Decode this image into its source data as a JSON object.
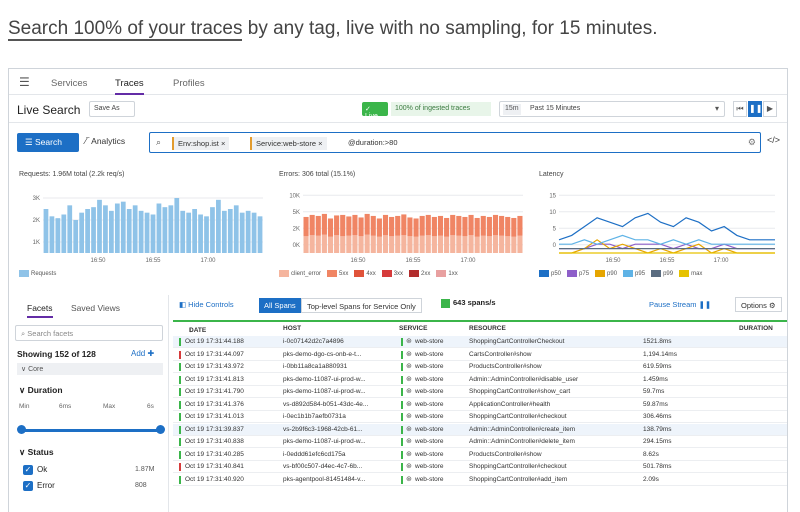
{
  "headline": {
    "link": "Search 100% of your traces",
    "rest": " by any tag, live with no sampling, for 15 minutes."
  },
  "nav": {
    "menu_icon": "menu-icon",
    "tabs": [
      "Services",
      "Traces",
      "Profiles"
    ],
    "active": "Traces"
  },
  "toolbar": {
    "title": "Live Search",
    "save_as": "Save As",
    "live_badge": "✓ Live",
    "ingest": "100% of ingested traces",
    "time_tag": "15m",
    "time_value": "Past 15 Minutes",
    "controls": [
      "⏮",
      "❚❚",
      "▶"
    ]
  },
  "search": {
    "search_label": "Search",
    "analytics_label": "Analytics",
    "chips": [
      "Env:shop.ist ×",
      "Service:web-store ×"
    ],
    "free_text": "@duration:>80"
  },
  "charts": {
    "requests_title": "Requests: 1.96M total (2.2k req/s)",
    "errors_title": "Errors: 306 total (15.1%)",
    "latency_title": "Latency"
  },
  "chart_data": [
    {
      "type": "bar",
      "title": "Requests: 1.96M total (2.2k req/s)",
      "ytick_labels": [
        "3K",
        "2K",
        "1K"
      ],
      "xtick_labels": [
        "16:50",
        "16:55",
        "17:00"
      ],
      "values": [
        2.4,
        2.0,
        1.9,
        2.1,
        2.6,
        1.8,
        2.2,
        2.4,
        2.5,
        2.9,
        2.6,
        2.3,
        2.7,
        2.8,
        2.4,
        2.6,
        2.3,
        2.2,
        2.1,
        2.7,
        2.5,
        2.6,
        3.0,
        2.3,
        2.2,
        2.4,
        2.1,
        2.0,
        2.5,
        2.9,
        2.3,
        2.4,
        2.6,
        2.2,
        2.3,
        2.2,
        2.0
      ],
      "ylim": [
        0,
        3.6
      ],
      "legend": [
        "Requests"
      ]
    },
    {
      "type": "bar",
      "title": "Errors: 306 total (15.1%)",
      "ytick_labels": [
        "10K",
        "5K",
        "2K",
        "0K"
      ],
      "xtick_labels": [
        "16:50",
        "16:55",
        "17:00"
      ],
      "stacked": true,
      "series": [
        {
          "name": "5xx",
          "color": "#f5b59e",
          "values": [
            3.3,
            3.5,
            3.4,
            3.6,
            3.2,
            3.5,
            3.3,
            3.4,
            3.5,
            3.3,
            3.6,
            3.4,
            3.2,
            3.5,
            3.3,
            3.4,
            3.5,
            3.3,
            3.2,
            3.4,
            3.5,
            3.3,
            3.4,
            3.2,
            3.5,
            3.4,
            3.3,
            3.5,
            3.2,
            3.4,
            3.3,
            3.5,
            3.4,
            3.3,
            3.2,
            3.4
          ]
        },
        {
          "name": "4xx",
          "color": "#f08564",
          "values": [
            3.8,
            4.0,
            3.9,
            4.1,
            3.6,
            3.9,
            4.2,
            3.8,
            4.0,
            3.7,
            4.1,
            3.9,
            3.6,
            4.0,
            3.8,
            3.9,
            4.1,
            3.7,
            3.6,
            3.9,
            4.0,
            3.8,
            3.9,
            3.7,
            4.0,
            3.9,
            3.8,
            4.0,
            3.7,
            3.9,
            3.8,
            4.0,
            3.9,
            3.8,
            3.7,
            3.9
          ]
        }
      ],
      "ylim": [
        0,
        13
      ],
      "legend": [
        "client_error",
        "5xx",
        "4xx",
        "3xx",
        "2xx",
        "1xx"
      ]
    },
    {
      "type": "line",
      "title": "Latency",
      "ytick_labels": [
        "15",
        "10",
        "5",
        "0"
      ],
      "xtick_labels": [
        "16:50",
        "16:55",
        "17:00"
      ],
      "series": [
        {
          "name": "p50",
          "color": "#1d6fc5",
          "values": [
            3,
            4,
            6,
            8,
            7,
            6,
            8,
            9,
            7,
            6,
            8,
            7,
            5,
            6,
            4,
            3,
            3,
            3
          ]
        },
        {
          "name": "p75",
          "color": "#8e5fc9",
          "values": [
            1,
            1,
            1,
            2,
            2,
            1,
            2,
            2,
            2,
            1,
            2,
            1,
            1,
            2,
            1,
            1,
            1,
            1
          ]
        },
        {
          "name": "p90",
          "color": "#e6a500",
          "values": [
            0,
            0,
            1,
            3,
            1,
            2,
            1,
            0,
            1,
            0,
            1,
            2,
            0,
            1,
            0,
            0,
            0,
            0
          ]
        },
        {
          "name": "p95",
          "color": "#5fb3e6",
          "values": [
            2,
            2,
            3,
            2,
            3,
            4,
            3,
            3,
            2,
            3,
            2,
            3,
            2,
            2,
            2,
            2,
            2,
            2
          ]
        },
        {
          "name": "p99",
          "color": "#5a6c80",
          "values": [
            1,
            1,
            1,
            1,
            1,
            1,
            1,
            1,
            1,
            1,
            1,
            1,
            1,
            1,
            1,
            1,
            1,
            1
          ]
        },
        {
          "name": "max",
          "color": "#e6c200",
          "values": [
            0,
            0,
            0,
            0,
            0,
            0,
            0,
            0,
            0,
            0,
            0,
            0,
            0,
            0,
            0,
            0,
            0,
            0
          ]
        }
      ],
      "ylim": [
        0,
        15
      ],
      "legend": [
        "p50",
        "p75",
        "p90",
        "p95",
        "p99",
        "max"
      ]
    }
  ],
  "facets": {
    "tabs": [
      "Facets",
      "Saved Views"
    ],
    "search_placeholder": "Search facets",
    "showing": "Showing 152 of 128",
    "add": "Add ✚",
    "core": "∨ Core",
    "duration": "∨ Duration",
    "duration_labels": [
      "Min",
      "6ms",
      "Max",
      "6s"
    ],
    "status": "∨ Status",
    "status_items": [
      {
        "label": "Ok",
        "count": "1.87M"
      },
      {
        "label": "Error",
        "count": "808"
      }
    ]
  },
  "table_toolbar": {
    "hide_controls": "Hide Controls",
    "all_spans": "All Spans",
    "top_level": "Top-level Spans for Service Only",
    "spans_rate": "643 spans/s",
    "pause": "Pause Stream ❚❚",
    "options": "Options ⚙"
  },
  "table": {
    "headers": [
      "DATE",
      "HOST",
      "SERVICE",
      "RESOURCE",
      "DURATION"
    ],
    "rows": [
      {
        "status": "ok",
        "date": "Oct 19 17:31:44.188",
        "host": "i-0c07142d2c7a4896",
        "service": "web-store",
        "resource": "ShoppingCartControllerCheckout",
        "duration": "1521.8ms"
      },
      {
        "status": "error",
        "date": "Oct 19 17:31:44.097",
        "host": "pks-demo-dgo-cs-onb-e-t...",
        "service": "web-store",
        "resource": "CartsController#show",
        "duration": "1,194.14ms"
      },
      {
        "status": "ok",
        "date": "Oct 19 17:31:43.972",
        "host": "i-0bb11a8ca1a880931",
        "service": "web-store",
        "resource": "ProductsController#show",
        "duration": "619.59ms"
      },
      {
        "status": "ok",
        "date": "Oct 19 17:31:41.813",
        "host": "pks-demo-11087-ui-prod-w...",
        "service": "web-store",
        "resource": "Admin::AdminController#disable_user",
        "duration": "1.459ms"
      },
      {
        "status": "ok",
        "date": "Oct 19 17:31:41.790",
        "host": "pks-demo-11087-ui-prod-w...",
        "service": "web-store",
        "resource": "ShoppingCartController#show_cart",
        "duration": "59.7ms"
      },
      {
        "status": "ok",
        "date": "Oct 19 17:31:41.376",
        "host": "vs-d892d584-b051-43dc-4e...",
        "service": "web-store",
        "resource": "ApplicationController#health",
        "duration": "59.87ms"
      },
      {
        "status": "ok",
        "date": "Oct 19 17:31:41.013",
        "host": "i-0ec1b1b7aefb0731a",
        "service": "web-store",
        "resource": "ShoppingCartController#checkout",
        "duration": "306.46ms"
      },
      {
        "status": "ok",
        "date": "Oct 19 17:31:39.837",
        "host": "vs-2b9f6c3-1968-42cb-61...",
        "service": "web-store",
        "resource": "Admin::AdminController#create_item",
        "duration": "138.79ms"
      },
      {
        "status": "ok",
        "date": "Oct 19 17:31:40.838",
        "host": "pks-demo-11087-ui-prod-w...",
        "service": "web-store",
        "resource": "Admin::AdminController#delete_item",
        "duration": "294.15ms"
      },
      {
        "status": "ok",
        "date": "Oct 19 17:31:40.285",
        "host": "i-0eddd61efc6cd175a",
        "service": "web-store",
        "resource": "ProductsController#show",
        "duration": "8.62s"
      },
      {
        "status": "error",
        "date": "Oct 19 17:31:40.841",
        "host": "vs-bf00c507-d4ec-4c7-6b...",
        "service": "web-store",
        "resource": "ShoppingCartController#checkout",
        "duration": "501.78ms"
      },
      {
        "status": "ok",
        "date": "Oct 19 17:31:40.920",
        "host": "pks-agentpool-81451484-v...",
        "service": "web-store",
        "resource": "ShoppingCartController#add_item",
        "duration": "2.09s"
      }
    ]
  },
  "colors": {
    "accent": "#1d6fc5",
    "ok": "#3bb54a",
    "error": "#d63b3b",
    "nav_active": "#632ca6"
  }
}
